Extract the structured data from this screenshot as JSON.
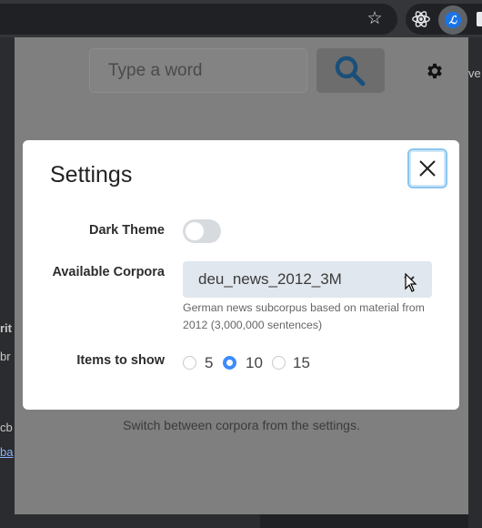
{
  "popup": {
    "search": {
      "placeholder": "Type a word"
    },
    "hint": "Switch between corpora from the settings."
  },
  "background_page": {
    "left_fragments": [
      "rit",
      "br",
      "cb",
      "ba"
    ],
    "right_fragment": "ve"
  },
  "settings_modal": {
    "title": "Settings",
    "dark_theme": {
      "label": "Dark Theme",
      "enabled": false
    },
    "corpora": {
      "label": "Available Corpora",
      "selected": "deu_news_2012_3M",
      "description": "German news subcorpus based on material from 2012 (3,000,000 sentences)"
    },
    "items_to_show": {
      "label": "Items to show",
      "options": [
        "5",
        "10",
        "15"
      ],
      "selected": "10"
    }
  },
  "colors": {
    "accent": "#3d8bfd",
    "focus_ring": "#8cc6ef",
    "search_icon": "#1a4f7a"
  }
}
